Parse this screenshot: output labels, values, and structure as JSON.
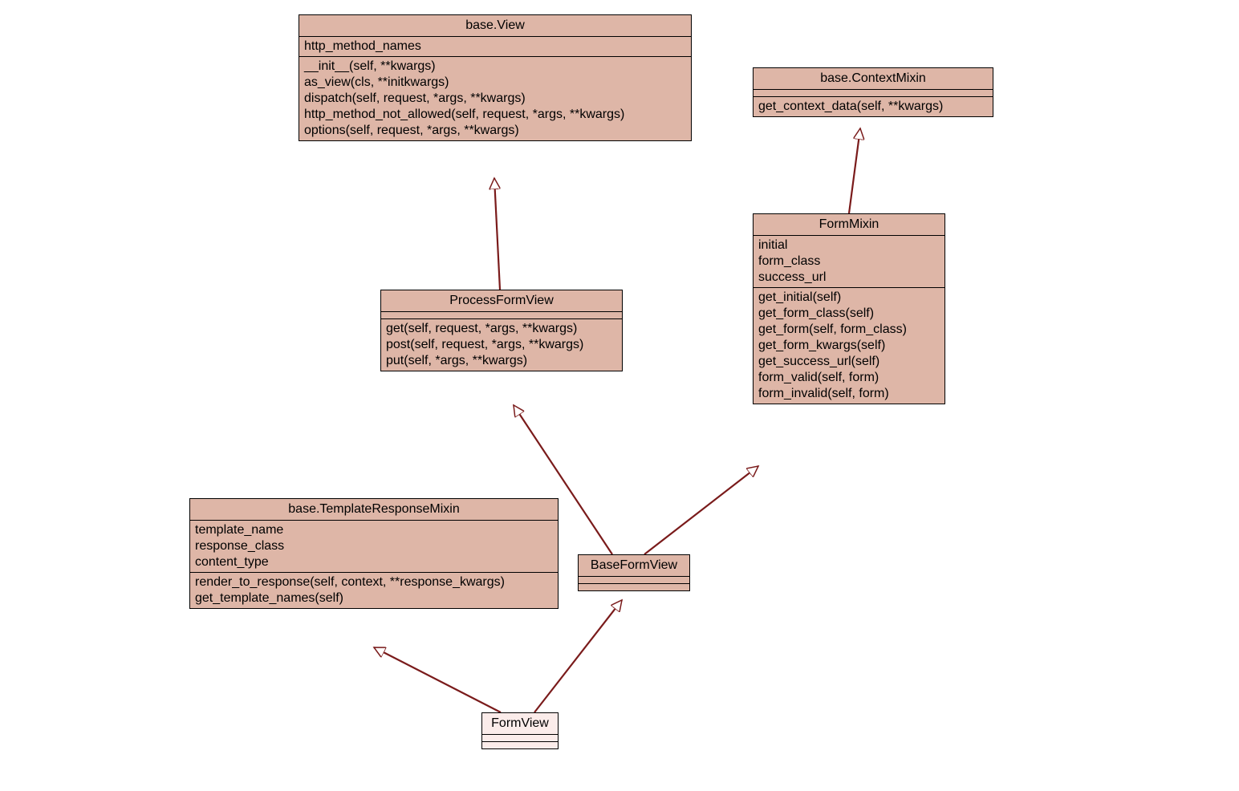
{
  "classes": {
    "baseView": {
      "title": "base.View",
      "attrs": [
        "http_method_names"
      ],
      "methods": [
        "__init__(self, **kwargs)",
        "as_view(cls, **initkwargs)",
        "dispatch(self, request, *args, **kwargs)",
        "http_method_not_allowed(self, request, *args, **kwargs)",
        "options(self, request, *args, **kwargs)"
      ]
    },
    "contextMixin": {
      "title": "base.ContextMixin",
      "methods": [
        "get_context_data(self, **kwargs)"
      ]
    },
    "processFormView": {
      "title": "ProcessFormView",
      "methods": [
        "get(self, request, *args, **kwargs)",
        "post(self, request, *args, **kwargs)",
        "put(self, *args, **kwargs)"
      ]
    },
    "formMixin": {
      "title": "FormMixin",
      "attrs": [
        "initial",
        "form_class",
        "success_url"
      ],
      "methods": [
        "get_initial(self)",
        "get_form_class(self)",
        "get_form(self, form_class)",
        "get_form_kwargs(self)",
        "get_success_url(self)",
        "form_valid(self, form)",
        "form_invalid(self, form)"
      ]
    },
    "templateResponseMixin": {
      "title": "base.TemplateResponseMixin",
      "attrs": [
        "template_name",
        "response_class",
        "content_type"
      ],
      "methods": [
        "render_to_response(self, context, **response_kwargs)",
        "get_template_names(self)"
      ]
    },
    "baseFormView": {
      "title": "BaseFormView"
    },
    "formView": {
      "title": "FormView"
    }
  },
  "colors": {
    "boxFill": "#deb6a7",
    "boxFillLight": "#fbecea",
    "arrow": "#7a1b1b",
    "border": "#000000"
  }
}
